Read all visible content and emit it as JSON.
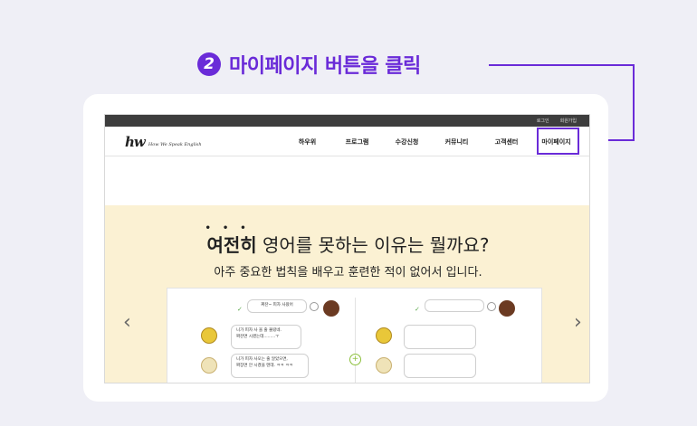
{
  "callout": {
    "step": "2",
    "text": "마이페이지 버튼을 클릭"
  },
  "site": {
    "topbar": {
      "login": "로그인",
      "signup": "회원가입"
    },
    "logo": {
      "mark": "hw",
      "sub": "How We Speak English"
    },
    "menu": [
      "하우위",
      "프로그램",
      "수강신청",
      "커뮤니티",
      "고객센터",
      "마이페이지"
    ],
    "banner": {
      "headline_emph": "여전히",
      "headline_dots": "•••",
      "headline_rest": " 영어를 못하는 이유는 뭘까요?",
      "subline": "아주 중요한 법칙을 배우고 훈련한 적이 없어서 입니다.",
      "arrow_left": "‹",
      "arrow_right": "›"
    },
    "demo": {
      "left_top": "짜잔~ 피자 사왔어",
      "left_mid": "니가 피자 사 올 줄 몰랐네.\n짜잔면 시켰는데.........ㅜ",
      "left_bottom": "니가 피자 사오는 줄 알았으면,\n짜장면 안 시켰을 텐데. ㅋㅋ ㅋㅋ",
      "plus": "+",
      "check": "✓"
    }
  }
}
